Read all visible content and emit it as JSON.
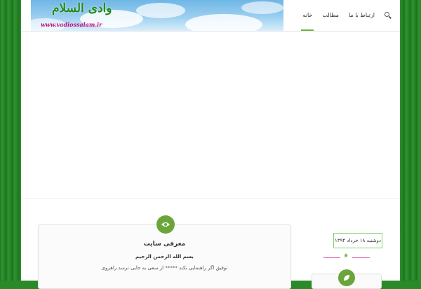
{
  "site": {
    "logo_text": "وادی السلام",
    "logo_url": "www.vadiossalam.ir"
  },
  "nav": {
    "items": [
      {
        "label": "خانه",
        "active": true
      },
      {
        "label": "مطالب",
        "active": false
      },
      {
        "label": "ارتباط با ما",
        "active": false
      }
    ],
    "search_icon": "search-icon"
  },
  "post": {
    "icon": "eye-icon",
    "title": "معرفی سایت",
    "line1": "بسم الله الرحمن الرحیم",
    "line2": "توفیق اگر راهنمایی نکند ***** از سعی به جایی نرسد راهروی"
  },
  "sidebar": {
    "date": "دوشنبه ۱۸ خرداد ۱۳۹۴",
    "star_icon": "star-icon",
    "widget_icon": "leaf-icon"
  },
  "colors": {
    "accent": "#6ba53a",
    "divider": "#d94aa6",
    "date_border": "#7fd36b",
    "background": "#2a8a2a"
  }
}
